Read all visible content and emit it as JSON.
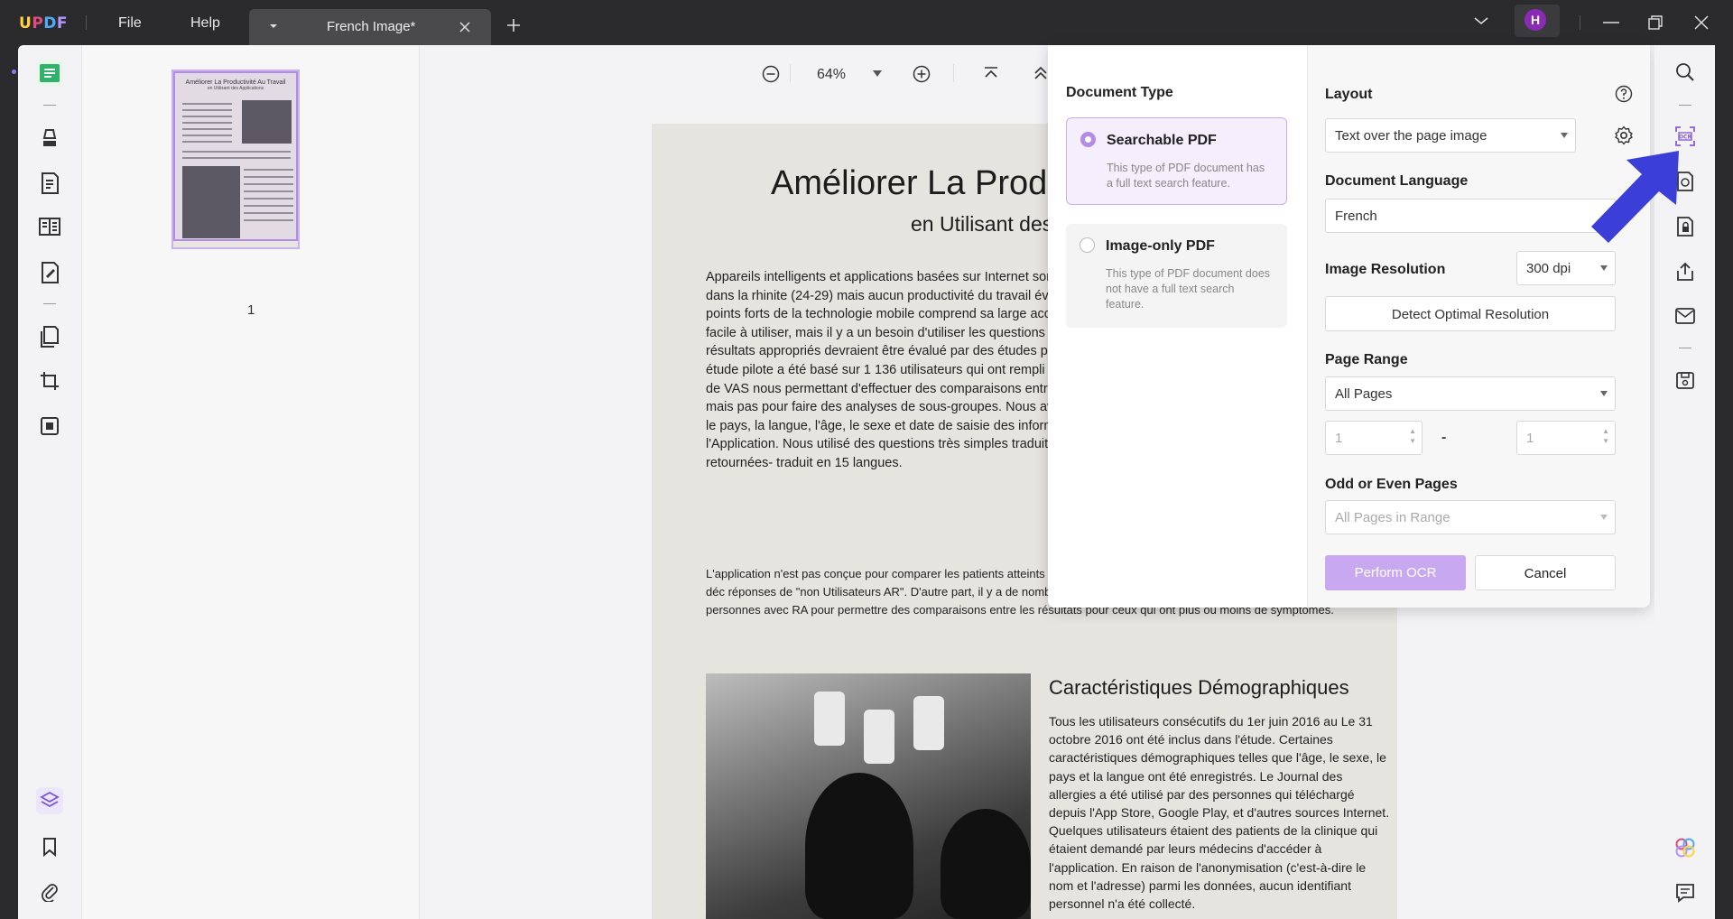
{
  "app": {
    "logo": {
      "u": "U",
      "p": "P",
      "d": "D",
      "f": "F"
    },
    "menu": {
      "file": "File",
      "help": "Help"
    },
    "tab_title": "French Image*",
    "avatar_letter": "H"
  },
  "thumbnails": {
    "page_number": "1",
    "thumb_title": "Améliorer La Productivité Au Travail",
    "thumb_sub": "en Utilisant des Applications"
  },
  "viewer": {
    "zoom": "64%"
  },
  "document": {
    "title": "Améliorer La Produ",
    "subtitle": "en Utilisant des",
    "para1": "Appareils intelligents et applications basées sur Internet sont déjà utilisés dans la rhinite (24-29) mais aucun productivité du travail évaluée. Les points forts de la technologie mobile comprend sa large acceptation et facile à utiliser, mais il y a un besoin d'utiliser les questions et les résultats appropriés devraient être évalué par des études pilotes. Cette étude pilote a été basé sur 1 136 utilisateurs qui ont rempli 5 789 jours de VAS nous permettant d'effectuer des comparaisons entre résultats, mais pas pour faire des analyses de sous-groupes. Nous avons collecté le pays, la langue, l'âge, le sexe et date de saisie des informations avec l'Application. Nous utilisé des questions très simples traduites et retournées- traduit en 15 langues.",
    "para2": "L'application n'est pas conçue pour comparer les patients atteints c clinique. Ainsi, comme prévu, plus de 98% des utilisateurs ont déc réponses de \"non Utilisateurs AR\". D'autre part, il y a de nombreux jours sans symptômes chez un nombre suffisant de personnes avec RA pour permettre des comparaisons entre les résultats pour ceux qui ont plus ou moins de symptômes.",
    "heading2": "Caractéristiques Démographiques",
    "para3": "Tous les utilisateurs consécutifs du 1er juin 2016 au Le 31 octobre 2016 ont été inclus dans l'étude. Certaines caractéristiques démographiques telles que l'âge, le sexe, le pays et la langue ont été enregistrés. Le Journal des allergies a été utilisé par des personnes qui téléchargé depuis l'App Store, Google Play, et d'autres sources Internet. Quelques utilisateurs étaient des patients de la clinique qui étaient demandé par leurs médecins d'accéder à l'application. En raison de l'anonymisation (c'est-à-dire le nom et l'adresse) parmi les données, aucun identifiant personnel n'a été collecté."
  },
  "ocr": {
    "doc_type_label": "Document Type",
    "options": [
      {
        "title": "Searchable PDF",
        "desc": "This type of PDF document has a full text search feature.",
        "selected": true
      },
      {
        "title": "Image-only PDF",
        "desc": "This type of PDF document does not have a full text search feature.",
        "selected": false
      }
    ],
    "layout_label": "Layout",
    "layout_value": "Text over the page image",
    "language_label": "Document Language",
    "language_value": "French",
    "resolution_label": "Image Resolution",
    "resolution_value": "300 dpi",
    "detect_button": "Detect Optimal Resolution",
    "page_range_label": "Page Range",
    "page_range_value": "All Pages",
    "range_from": "1",
    "range_dash": "-",
    "range_to": "1",
    "odd_even_label": "Odd or Even Pages",
    "odd_even_value": "All Pages in Range",
    "perform_button": "Perform OCR",
    "cancel_button": "Cancel"
  },
  "colors": {
    "accent": "#b38ce6",
    "arrow": "#3b3fd8",
    "titlebar": "#2b2b2e"
  }
}
